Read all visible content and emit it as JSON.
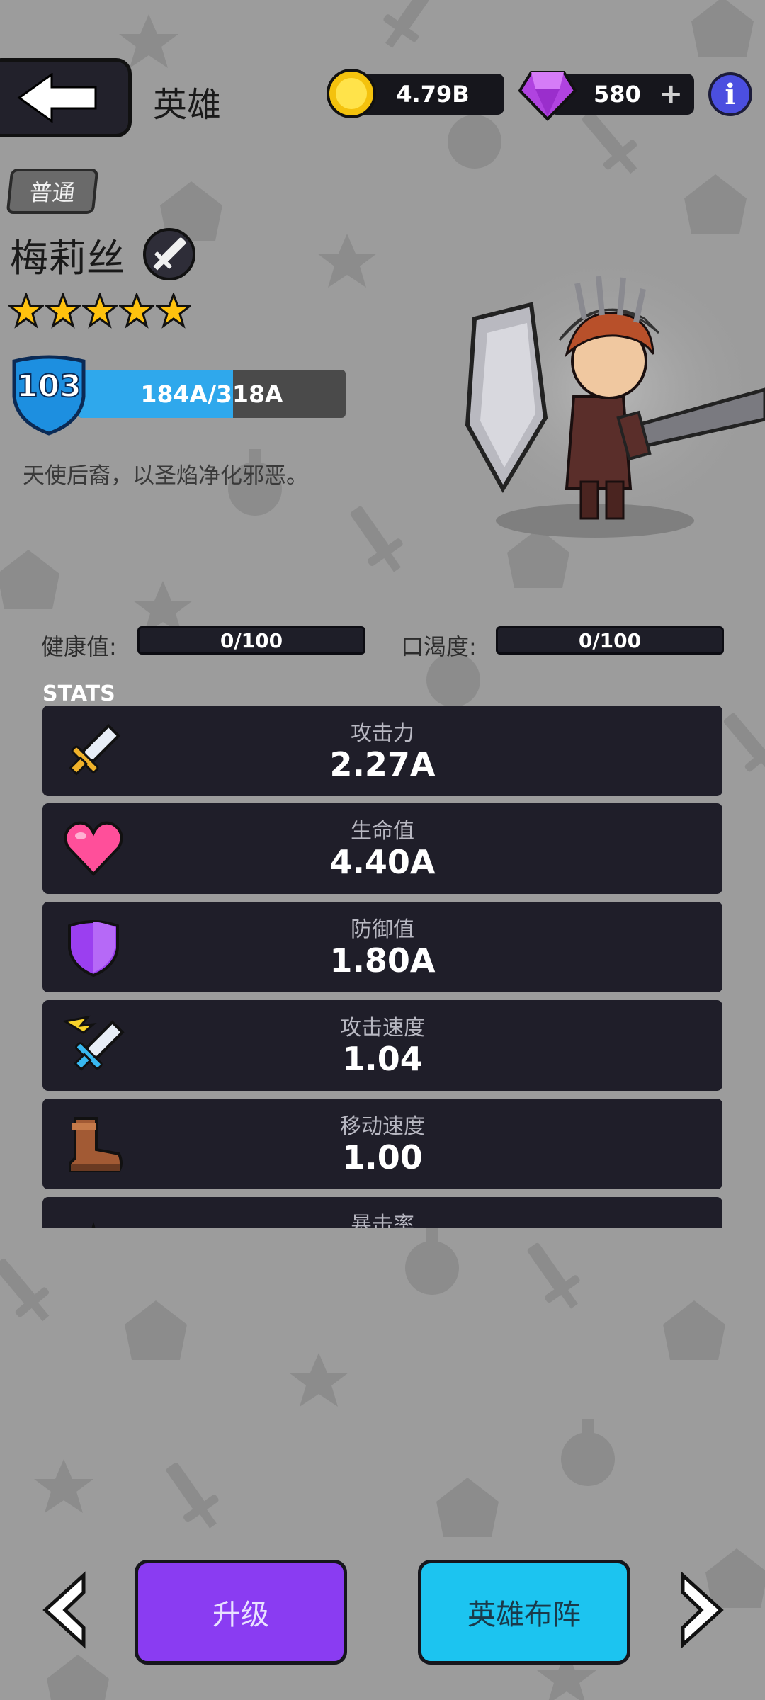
{
  "header": {
    "title": "英雄",
    "coins": "4.79B",
    "gems": "580",
    "gems_add": "+",
    "info": "i"
  },
  "hero": {
    "rarity": "普通",
    "name": "梅莉丝",
    "class_icon": "sword-icon",
    "stars": 5,
    "level": "103",
    "exp_text": "184A/318A",
    "exp_fraction": 0.58,
    "description": "天使后裔，以圣焰净化邪恶。"
  },
  "conditions": {
    "health_label": "健康值:",
    "health_value": "0/100",
    "thirst_label": "口渴度:",
    "thirst_value": "0/100"
  },
  "stats": {
    "heading": "STATS",
    "items": [
      {
        "label": "攻击力",
        "value": "2.27A",
        "icon": "sword-icon"
      },
      {
        "label": "生命值",
        "value": "4.40A",
        "icon": "heart-icon"
      },
      {
        "label": "防御值",
        "value": "1.80A",
        "icon": "shield-icon"
      },
      {
        "label": "攻击速度",
        "value": "1.04",
        "icon": "winged-sword-icon"
      },
      {
        "label": "移动速度",
        "value": "1.00",
        "icon": "boot-icon"
      },
      {
        "label": "暴击率",
        "value": "",
        "icon": "crit-icon"
      }
    ]
  },
  "footer": {
    "upgrade_label": "升级",
    "formation_label": "英雄布阵"
  },
  "colors": {
    "accent_purple": "#8a3cf2",
    "accent_cyan": "#1cc4f0",
    "exp_blue": "#2fa8ec",
    "card_bg": "#1f1e29"
  }
}
